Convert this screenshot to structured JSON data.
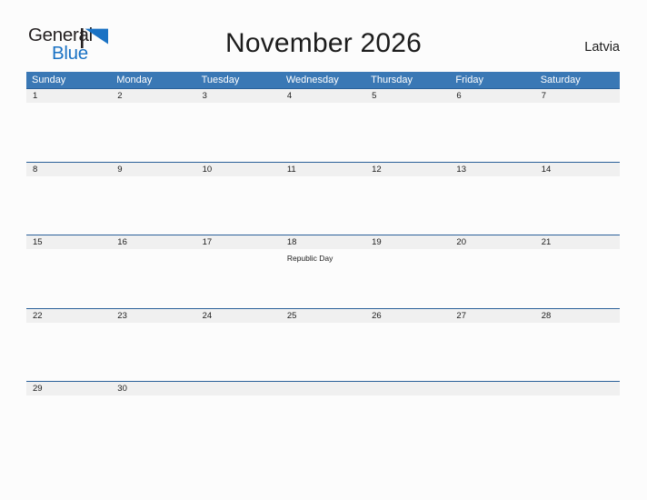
{
  "brand": {
    "name_part1": "General",
    "name_part2": "Blue",
    "flag_icon": "blue-flag-triangle-icon",
    "color_dark": "#231f20",
    "color_blue": "#1a72c4"
  },
  "header": {
    "title": "November 2026",
    "country": "Latvia"
  },
  "theme": {
    "header_band": "#3a78b5",
    "row_rule": "#2a6099",
    "daynum_band": "#f0f0f0",
    "page_background": "#fcfcfc",
    "text": "#1c1c1c"
  },
  "calendar": {
    "weekdays": [
      "Sunday",
      "Monday",
      "Tuesday",
      "Wednesday",
      "Thursday",
      "Friday",
      "Saturday"
    ],
    "weeks": [
      {
        "days": [
          {
            "date": "1",
            "events": []
          },
          {
            "date": "2",
            "events": []
          },
          {
            "date": "3",
            "events": []
          },
          {
            "date": "4",
            "events": []
          },
          {
            "date": "5",
            "events": []
          },
          {
            "date": "6",
            "events": []
          },
          {
            "date": "7",
            "events": []
          }
        ]
      },
      {
        "days": [
          {
            "date": "8",
            "events": []
          },
          {
            "date": "9",
            "events": []
          },
          {
            "date": "10",
            "events": []
          },
          {
            "date": "11",
            "events": []
          },
          {
            "date": "12",
            "events": []
          },
          {
            "date": "13",
            "events": []
          },
          {
            "date": "14",
            "events": []
          }
        ]
      },
      {
        "days": [
          {
            "date": "15",
            "events": []
          },
          {
            "date": "16",
            "events": []
          },
          {
            "date": "17",
            "events": []
          },
          {
            "date": "18",
            "events": [
              "Republic Day"
            ]
          },
          {
            "date": "19",
            "events": []
          },
          {
            "date": "20",
            "events": []
          },
          {
            "date": "21",
            "events": []
          }
        ]
      },
      {
        "days": [
          {
            "date": "22",
            "events": []
          },
          {
            "date": "23",
            "events": []
          },
          {
            "date": "24",
            "events": []
          },
          {
            "date": "25",
            "events": []
          },
          {
            "date": "26",
            "events": []
          },
          {
            "date": "27",
            "events": []
          },
          {
            "date": "28",
            "events": []
          }
        ]
      },
      {
        "last": true,
        "days": [
          {
            "date": "29",
            "events": []
          },
          {
            "date": "30",
            "events": []
          },
          {
            "date": "",
            "events": []
          },
          {
            "date": "",
            "events": []
          },
          {
            "date": "",
            "events": []
          },
          {
            "date": "",
            "events": []
          },
          {
            "date": "",
            "events": []
          }
        ]
      }
    ]
  }
}
